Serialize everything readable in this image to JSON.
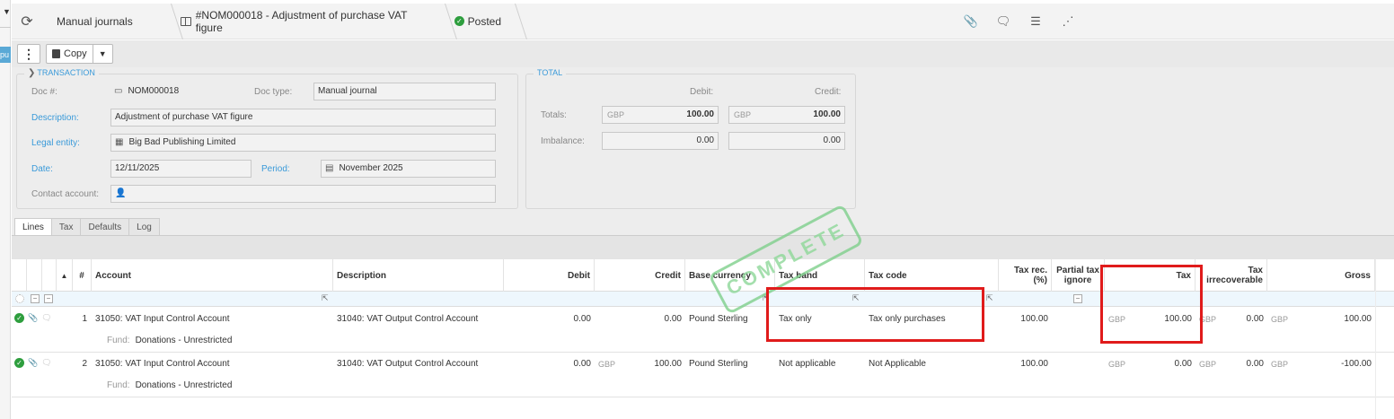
{
  "left_strip": {
    "tab_text": "pu"
  },
  "breadcrumbs": [
    {
      "label": "Manual journals"
    },
    {
      "label": "#NOM000018 - Adjustment of purchase VAT figure"
    },
    {
      "label": "Posted"
    }
  ],
  "toolbar": {
    "copy_label": "Copy"
  },
  "transaction": {
    "legend": "TRANSACTION",
    "doc_no_label": "Doc #:",
    "doc_no": "NOM000018",
    "doc_type_label": "Doc type:",
    "doc_type": "Manual journal",
    "description_label": "Description:",
    "description": "Adjustment of purchase VAT figure",
    "legal_entity_label": "Legal entity:",
    "legal_entity": "Big Bad Publishing Limited",
    "date_label": "Date:",
    "date": "12/11/2025",
    "period_label": "Period:",
    "period": "November 2025",
    "contact_label": "Contact account:",
    "contact": ""
  },
  "total": {
    "legend": "TOTAL",
    "debit_label": "Debit:",
    "credit_label": "Credit:",
    "totals_label": "Totals:",
    "imbalance_label": "Imbalance:",
    "currency": "GBP",
    "debit_total": "100.00",
    "credit_total": "100.00",
    "debit_imbalance": "0.00",
    "credit_imbalance": "0.00"
  },
  "tabs": [
    "Lines",
    "Tax",
    "Defaults",
    "Log"
  ],
  "grid": {
    "headers": {
      "sort": "▲",
      "num": "#",
      "account": "Account",
      "description": "Description",
      "debit": "Debit",
      "credit": "Credit",
      "base_currency": "Base currency",
      "tax_band": "Tax band",
      "tax_code": "Tax code",
      "tax_rec": "Tax rec. (%)",
      "partial_tax": "Partial tax ignore",
      "tax": "Tax",
      "tax_irrecoverable": "Tax irrecoverable",
      "gross": "Gross"
    },
    "rows": [
      {
        "num": "1",
        "account": "31050: VAT Input Control Account",
        "description": "31040: VAT Output Control Account",
        "debit": "0.00",
        "credit_cur": "",
        "credit": "0.00",
        "base_currency": "Pound Sterling",
        "tax_band": "Tax only",
        "tax_code": "Tax only purchases",
        "tax_rec": "100.00",
        "tax_cur": "GBP",
        "tax": "100.00",
        "irr_cur": "GBP",
        "tax_irrecoverable": "0.00",
        "gross_cur": "GBP",
        "gross": "100.00",
        "fund_label": "Fund:",
        "fund": "Donations - Unrestricted"
      },
      {
        "num": "2",
        "account": "31050: VAT Input Control Account",
        "description": "31040: VAT Output Control Account",
        "debit": "0.00",
        "credit_cur": "GBP",
        "credit": "100.00",
        "base_currency": "Pound Sterling",
        "tax_band": "Not applicable",
        "tax_code": "Not Applicable",
        "tax_rec": "100.00",
        "tax_cur": "GBP",
        "tax": "0.00",
        "irr_cur": "GBP",
        "tax_irrecoverable": "0.00",
        "gross_cur": "GBP",
        "gross": "-100.00",
        "fund_label": "Fund:",
        "fund": "Donations - Unrestricted"
      }
    ]
  },
  "stamp_text": "COMPLETE",
  "colors": {
    "accent": "#3a9ad9",
    "success": "#2e9e3e",
    "highlight": "#e01b1b",
    "stamp": "#7fd08c"
  }
}
